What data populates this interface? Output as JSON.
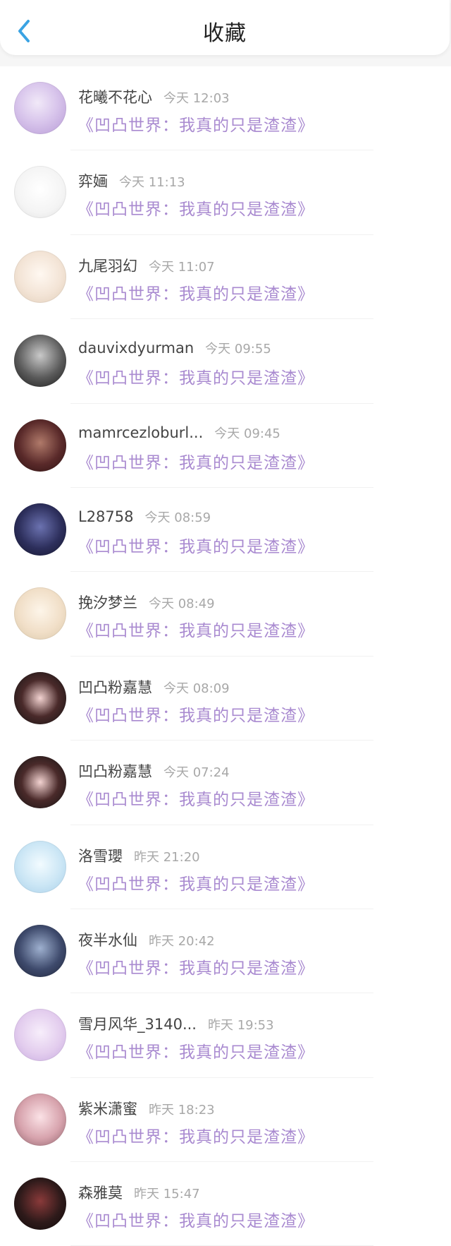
{
  "header": {
    "title": "收藏"
  },
  "colors": {
    "accent_back": "#3aa3e3",
    "work_link": "#a98ad0",
    "time_text": "#a8a8a8"
  },
  "items": [
    {
      "name": "花曦不花心",
      "time": "今天 12:03",
      "work": "《凹凸世界：我真的只是渣渣》",
      "avatar_bg": "radial-gradient(circle at 45% 40%, #f1e9f8 0%, #d9c6ec 45%, #b79ad6 100%)"
    },
    {
      "name": "弈婳",
      "time": "今天 11:13",
      "work": "《凹凸世界：我真的只是渣渣》",
      "avatar_bg": "radial-gradient(circle at 50% 45%, #ffffff 0%, #f4f4f4 60%, #dedede 100%)"
    },
    {
      "name": "九尾羽幻",
      "time": "今天 11:07",
      "work": "《凹凸世界：我真的只是渣渣》",
      "avatar_bg": "radial-gradient(circle at 50% 45%, #fff8f1 0%, #f3e4d6 55%, #e0cdb8 100%)"
    },
    {
      "name": "dauvixdyurman",
      "time": "今天 09:55",
      "work": "《凹凸世界：我真的只是渣渣》",
      "avatar_bg": "radial-gradient(circle at 50% 40%, #c9c9c9 0%, #5a5a5a 55%, #1b1b1b 100%)"
    },
    {
      "name": "mamrcezloburl...",
      "time": "今天 09:45",
      "work": "《凹凸世界：我真的只是渣渣》",
      "avatar_bg": "radial-gradient(circle at 50% 45%, #b07a6a 0%, #5a2a2a 55%, #2a1010 100%)"
    },
    {
      "name": "L28758",
      "time": "今天 08:59",
      "work": "《凹凸世界：我真的只是渣渣》",
      "avatar_bg": "radial-gradient(circle at 50% 45%, #6b72b0 0%, #2d2f5c 55%, #14152c 100%)"
    },
    {
      "name": "挽汐梦兰",
      "time": "今天 08:49",
      "work": "《凹凸世界：我真的只是渣渣》",
      "avatar_bg": "radial-gradient(circle at 50% 45%, #fdf5e9 0%, #f1dfc8 55%, #d9c7a8 100%)"
    },
    {
      "name": "凹凸粉嘉慧",
      "time": "今天 08:09",
      "work": "《凹凸世界：我真的只是渣渣》",
      "avatar_bg": "radial-gradient(circle at 50% 50%, #f3d3d1 0%, #4a2a2a 50%, #121212 100%)"
    },
    {
      "name": "凹凸粉嘉慧",
      "time": "今天 07:24",
      "work": "《凹凸世界：我真的只是渣渣》",
      "avatar_bg": "radial-gradient(circle at 50% 50%, #f3d3d1 0%, #4a2a2a 50%, #121212 100%)"
    },
    {
      "name": "洛雪瓔",
      "time": "昨天 21:20",
      "work": "《凹凸世界：我真的只是渣渣》",
      "avatar_bg": "radial-gradient(circle at 50% 45%, #f2fbff 0%, #cbe6f5 55%, #a7cfe9 100%)"
    },
    {
      "name": "夜半水仙",
      "time": "昨天 20:42",
      "work": "《凹凸世界：我真的只是渣渣》",
      "avatar_bg": "radial-gradient(circle at 50% 45%, #9eb0cf 0%, #3e4a6c 55%, #1e2438 100%)"
    },
    {
      "name": "雪月风华_3140...",
      "time": "昨天 19:53",
      "work": "《凹凸世界：我真的只是渣渣》",
      "avatar_bg": "radial-gradient(circle at 50% 45%, #f7eefb 0%, #e3cdee 55%, #c6a9df 100%)"
    },
    {
      "name": "紫米潇蜜",
      "time": "昨天 18:23",
      "work": "《凹凸世界：我真的只是渣渣》",
      "avatar_bg": "radial-gradient(circle at 50% 45%, #fbe2e6 0%, #d7a3ad 55%, #8b5f68 100%)"
    },
    {
      "name": "森雅莫",
      "time": "昨天 15:47",
      "work": "《凹凸世界：我真的只是渣渣》",
      "avatar_bg": "radial-gradient(circle at 50% 45%, #8a3a3a 0%, #2e1a1a 55%, #0f0a0a 100%)"
    }
  ]
}
